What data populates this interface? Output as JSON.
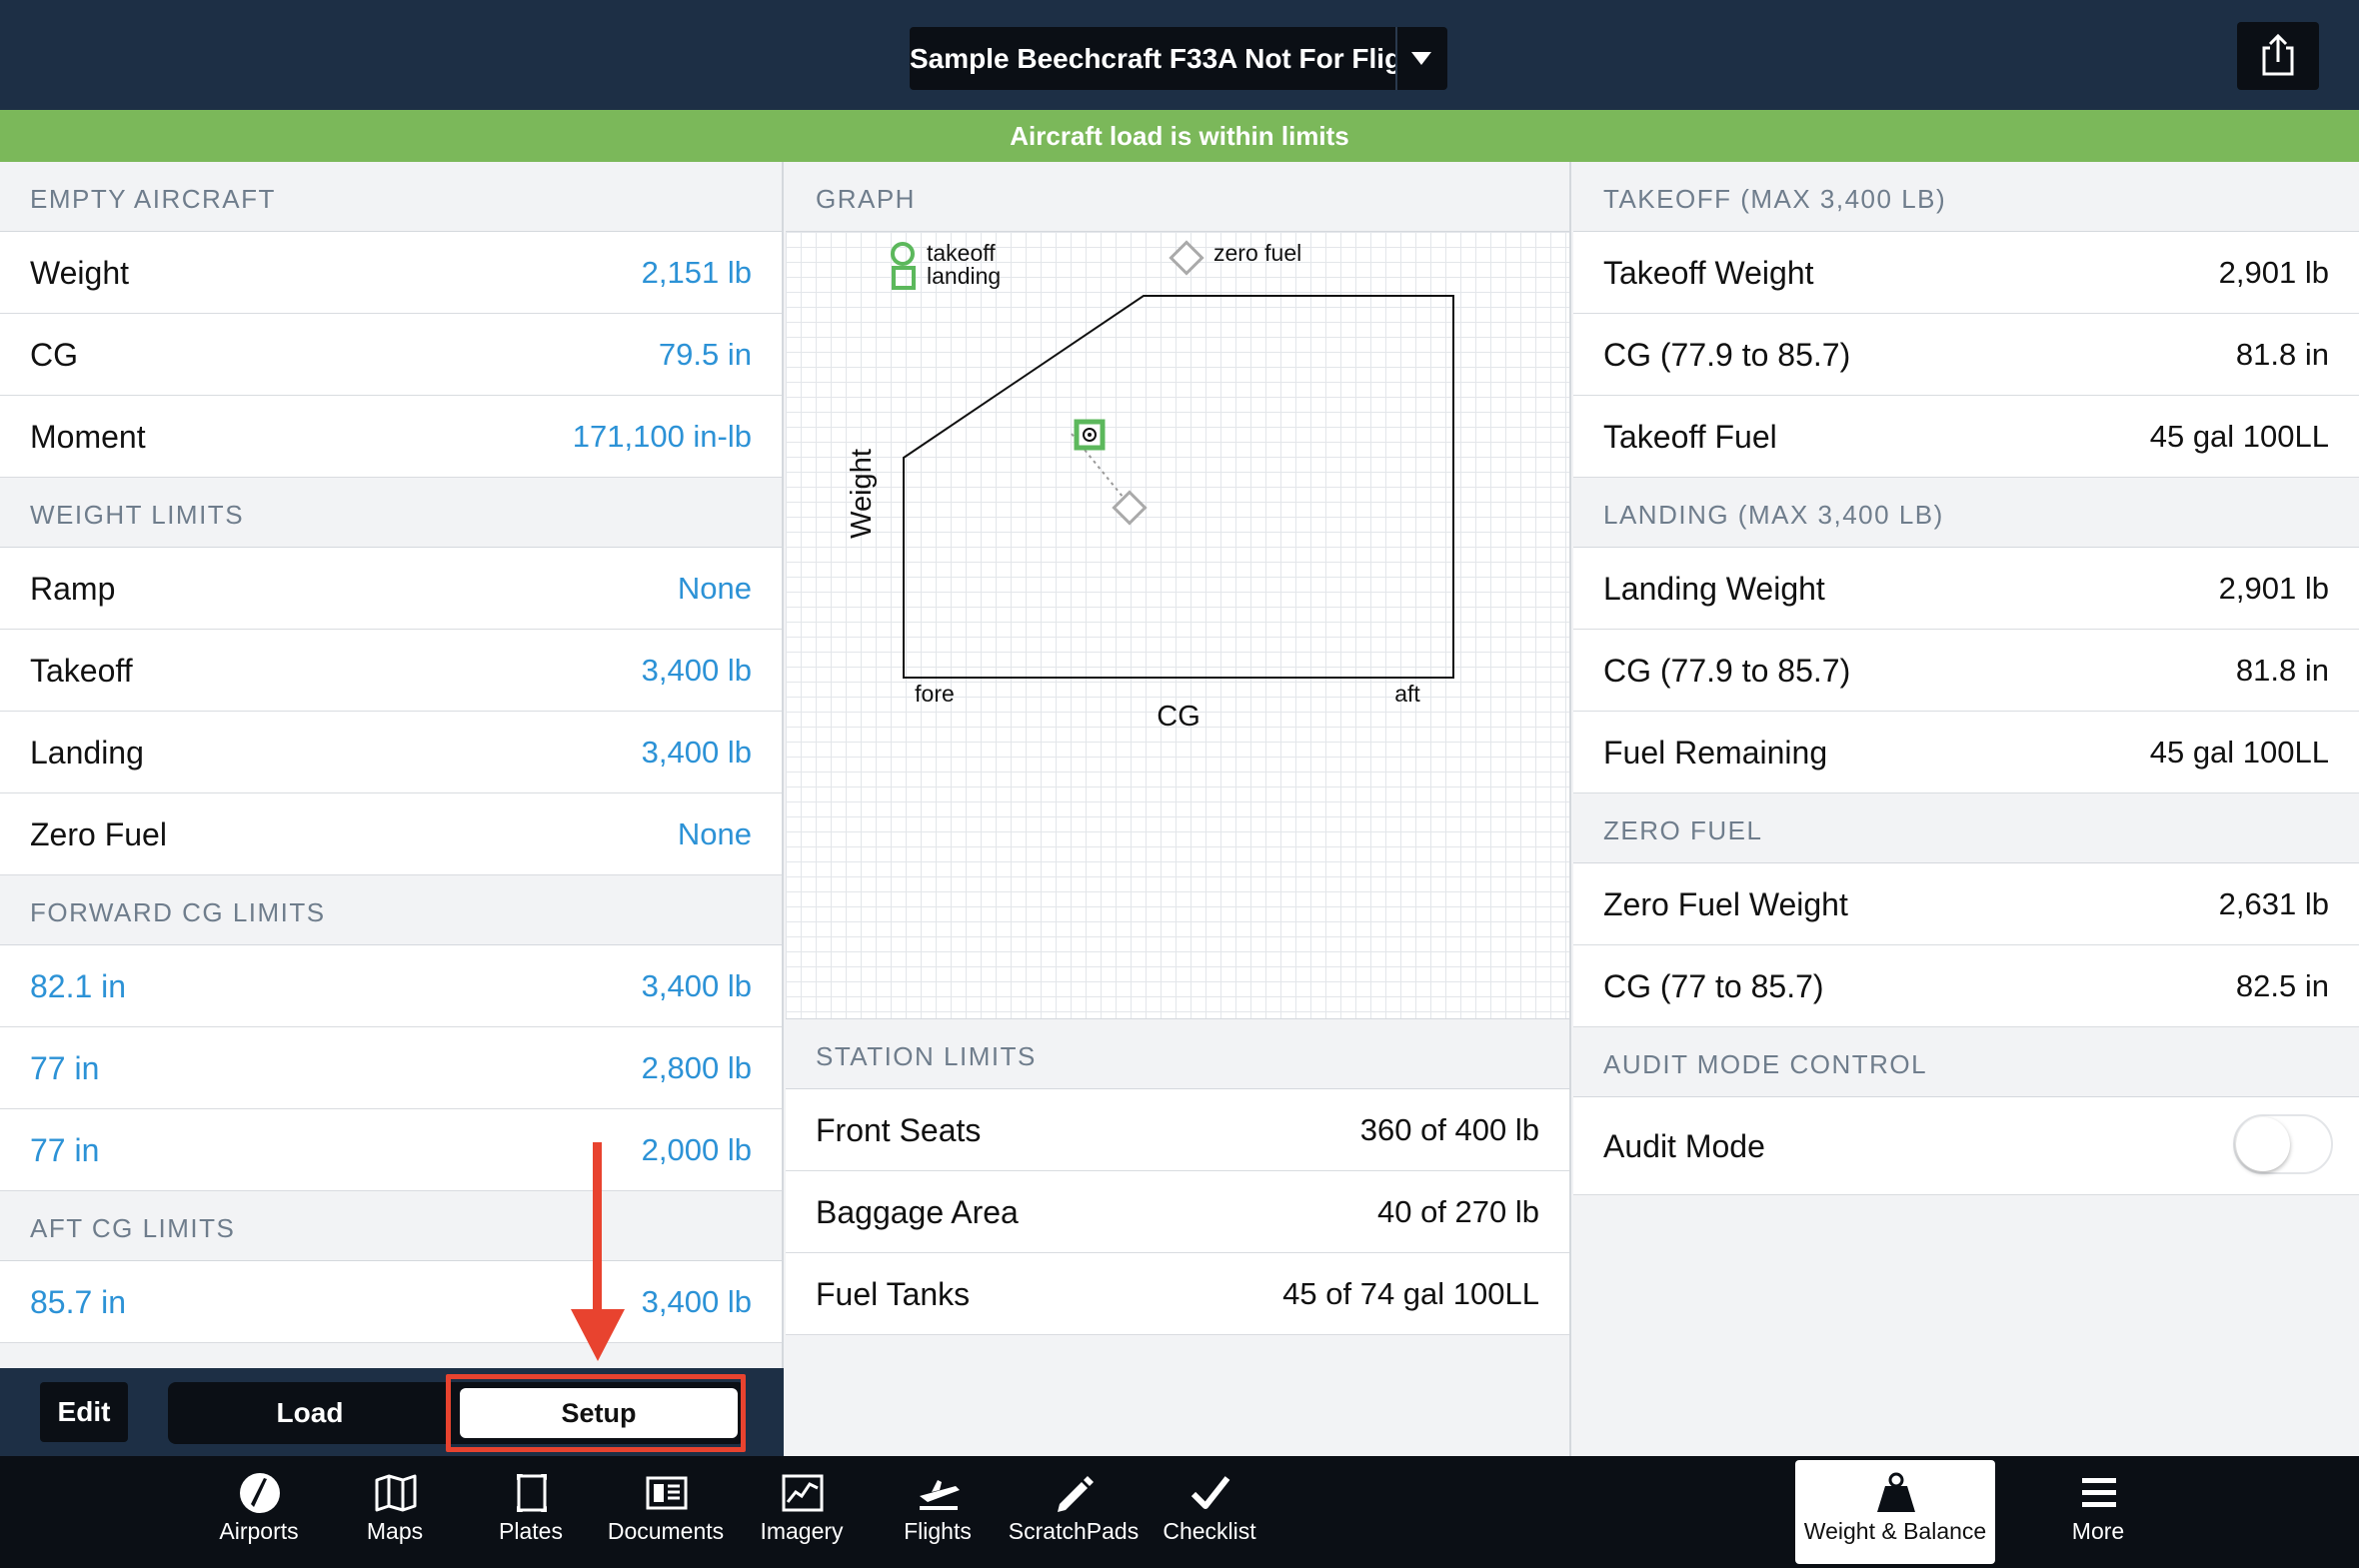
{
  "header": {
    "aircraft_name": "Sample Beechcraft F33A Not For Flig…",
    "share_icon": "share-icon",
    "caret_icon": "chevron-down-icon"
  },
  "banner": {
    "text": "Aircraft load is within limits",
    "color": "#7bb85a"
  },
  "left": {
    "empty_aircraft": {
      "title": "EMPTY AIRCRAFT",
      "rows": [
        {
          "label": "Weight",
          "value": "2,151 lb"
        },
        {
          "label": "CG",
          "value": "79.5 in"
        },
        {
          "label": "Moment",
          "value": "171,100 in-lb"
        }
      ]
    },
    "weight_limits": {
      "title": "WEIGHT LIMITS",
      "rows": [
        {
          "label": "Ramp",
          "value": "None"
        },
        {
          "label": "Takeoff",
          "value": "3,400 lb"
        },
        {
          "label": "Landing",
          "value": "3,400 lb"
        },
        {
          "label": "Zero Fuel",
          "value": "None"
        }
      ]
    },
    "forward_cg_limits": {
      "title": "FORWARD CG LIMITS",
      "rows": [
        {
          "label": "82.1 in",
          "value": "3,400 lb"
        },
        {
          "label": "77 in",
          "value": "2,800 lb"
        },
        {
          "label": "77 in",
          "value": "2,000 lb"
        }
      ]
    },
    "aft_cg_limits": {
      "title": "AFT CG LIMITS",
      "rows": [
        {
          "label": "85.7 in",
          "value": "3,400 lb"
        }
      ]
    },
    "bottom": {
      "edit": "Edit",
      "load": "Load",
      "setup": "Setup",
      "selected": "Setup"
    }
  },
  "middle": {
    "graph": {
      "title": "GRAPH",
      "legend": {
        "takeoff": "takeoff",
        "landing": "landing",
        "zero_fuel": "zero fuel"
      },
      "axis_y": "Weight",
      "axis_x": "CG",
      "x_left": "fore",
      "x_right": "aft"
    },
    "station_limits": {
      "title": "STATION LIMITS",
      "rows": [
        {
          "label": "Front Seats",
          "value": "360 of 400 lb"
        },
        {
          "label": "Baggage Area",
          "value": "40 of 270 lb"
        },
        {
          "label": "Fuel Tanks",
          "value": "45 of 74 gal 100LL"
        }
      ]
    }
  },
  "right": {
    "takeoff": {
      "title": "TAKEOFF (MAX 3,400 LB)",
      "rows": [
        {
          "label": "Takeoff Weight",
          "value": "2,901 lb"
        },
        {
          "label": "CG (77.9 to 85.7)",
          "value": "81.8 in"
        },
        {
          "label": "Takeoff Fuel",
          "value": "45 gal 100LL"
        }
      ]
    },
    "landing": {
      "title": "LANDING (MAX 3,400 LB)",
      "rows": [
        {
          "label": "Landing Weight",
          "value": "2,901 lb"
        },
        {
          "label": "CG (77.9 to 85.7)",
          "value": "81.8 in"
        },
        {
          "label": "Fuel Remaining",
          "value": "45 gal 100LL"
        }
      ]
    },
    "zero_fuel": {
      "title": "ZERO FUEL",
      "rows": [
        {
          "label": "Zero Fuel Weight",
          "value": "2,631 lb"
        },
        {
          "label": "CG (77 to 85.7)",
          "value": "82.5 in"
        }
      ]
    },
    "audit": {
      "title": "AUDIT MODE CONTROL",
      "label": "Audit Mode",
      "enabled": false
    }
  },
  "tabbar": {
    "items": [
      {
        "label": "Airports",
        "icon": "airports-icon"
      },
      {
        "label": "Maps",
        "icon": "maps-icon"
      },
      {
        "label": "Plates",
        "icon": "plates-icon"
      },
      {
        "label": "Documents",
        "icon": "documents-icon"
      },
      {
        "label": "Imagery",
        "icon": "imagery-icon"
      },
      {
        "label": "Flights",
        "icon": "flights-icon"
      },
      {
        "label": "ScratchPads",
        "icon": "scratchpads-icon"
      },
      {
        "label": "Checklist",
        "icon": "checklist-icon"
      },
      {
        "label": "Weight & Balance",
        "icon": "weight-balance-icon",
        "active": true
      },
      {
        "label": "More",
        "icon": "more-icon"
      }
    ]
  }
}
